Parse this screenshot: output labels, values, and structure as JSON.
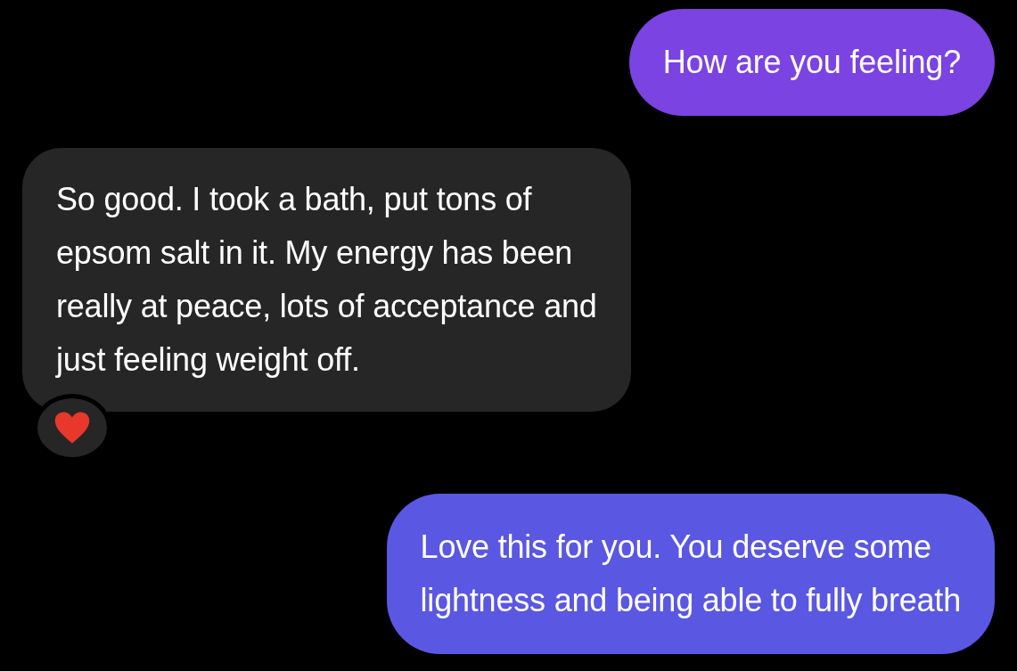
{
  "messages": [
    {
      "kind": "outgoing",
      "text": "How are you feeling?"
    },
    {
      "kind": "incoming",
      "text": "So good. I took a bath, put tons of\nepsom salt in it. My energy has been\nreally at peace, lots of acceptance and\njust feeling weight off.",
      "reaction": {
        "kind": "heart"
      }
    },
    {
      "kind": "outgoing",
      "text": "Love this for you. You deserve some\nlightness and being able to fully breath"
    }
  ]
}
